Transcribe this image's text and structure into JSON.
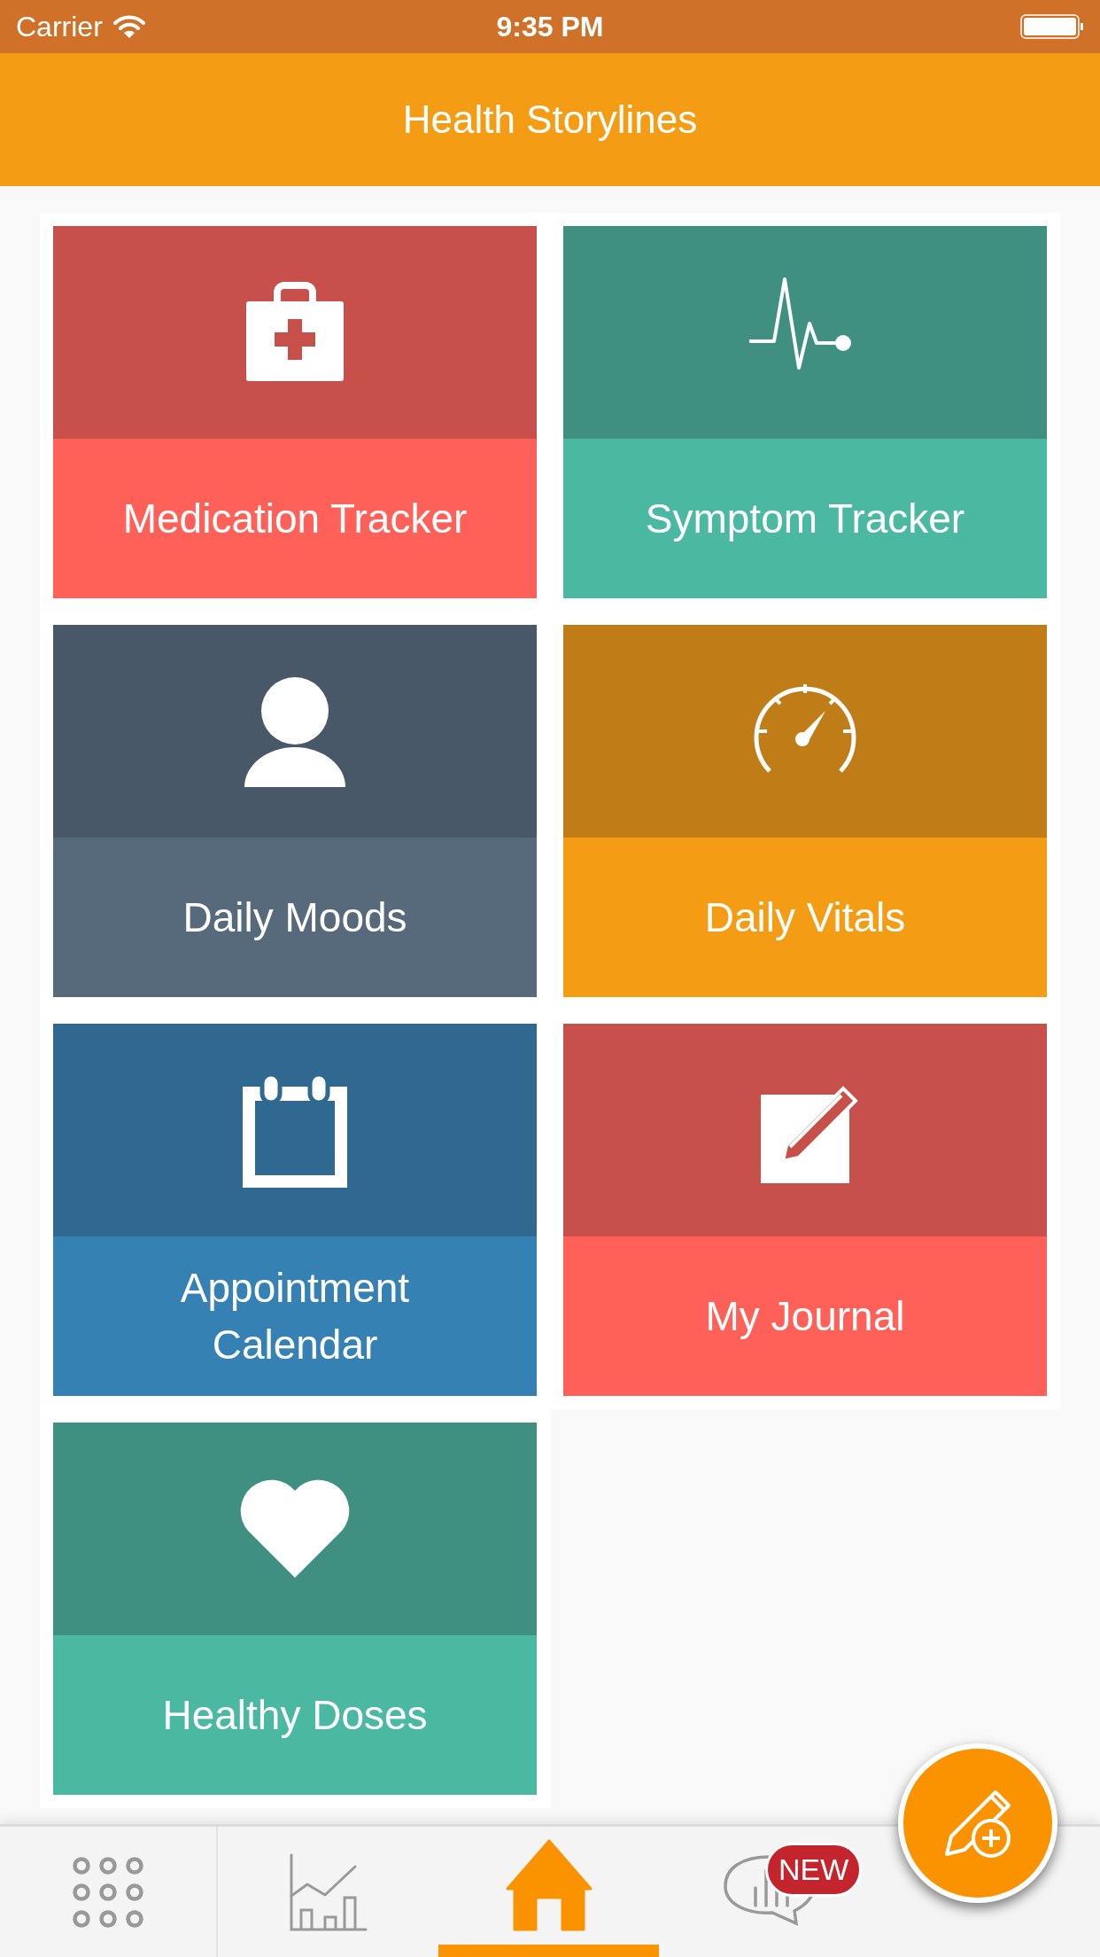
{
  "status_bar": {
    "carrier": "Carrier",
    "time": "9:35 PM"
  },
  "header": {
    "title": "Health Storylines"
  },
  "tiles": [
    {
      "kind": "medkit",
      "color": "#c8504a",
      "caption": {
        "text": "Medication Tracker",
        "color": "#ff6058"
      }
    },
    {
      "kind": "pulse",
      "color": "#3f9080",
      "caption": {
        "text": "Symptom Tracker",
        "color": "#4bb8a2"
      }
    },
    {
      "kind": "person",
      "color": "#485868",
      "caption": {
        "text": "Daily Moods",
        "color": "#566a7b"
      }
    },
    {
      "kind": "gauge",
      "color": "#bf7c17",
      "caption": {
        "text": "Daily Vitals",
        "color": "#f39c14"
      }
    },
    {
      "kind": "calendar",
      "color": "#2f6891",
      "caption": {
        "text": "Appointment Calendar",
        "color": "#3681b4"
      }
    },
    {
      "kind": "journal",
      "color": "#c8504a",
      "caption": {
        "text": "My Journal",
        "color": "#ff6058"
      }
    },
    {
      "kind": "heart",
      "color": "#3f9080",
      "caption": {
        "text": "Healthy Doses",
        "color": "#4bb8a2"
      }
    }
  ],
  "tab_bar": [
    {
      "kind": "grid",
      "selected": false
    },
    {
      "kind": "chart",
      "selected": false
    },
    {
      "kind": "home",
      "selected": true
    },
    {
      "kind": "chat",
      "selected": false,
      "badge": "NEW"
    }
  ],
  "fab": {
    "kind": "compose"
  }
}
